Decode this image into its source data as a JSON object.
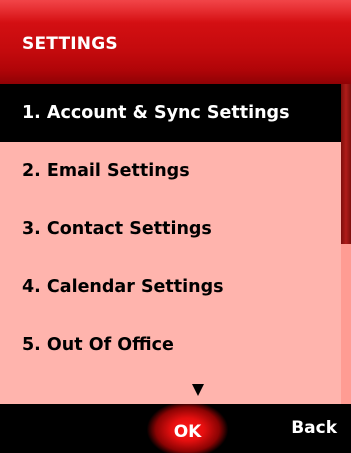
{
  "header": {
    "title": "SETTINGS"
  },
  "menu": {
    "items": [
      {
        "label": "1. Account & Sync Settings",
        "selected": true
      },
      {
        "label": "2. Email Settings",
        "selected": false
      },
      {
        "label": "3. Contact Settings",
        "selected": false
      },
      {
        "label": "4. Calendar Settings",
        "selected": false
      },
      {
        "label": "5. Out Of Office",
        "selected": false
      }
    ],
    "more_indicator": "down-arrow-icon"
  },
  "scrollbar": {
    "visible_fraction": 0.5,
    "position": 0
  },
  "softkeys": {
    "center": "OK",
    "right": "Back"
  },
  "colors": {
    "title_bar": "#c30a0d",
    "list_background": "#ffb4ad",
    "selection": "#000000",
    "softkey_bar": "#000000"
  }
}
